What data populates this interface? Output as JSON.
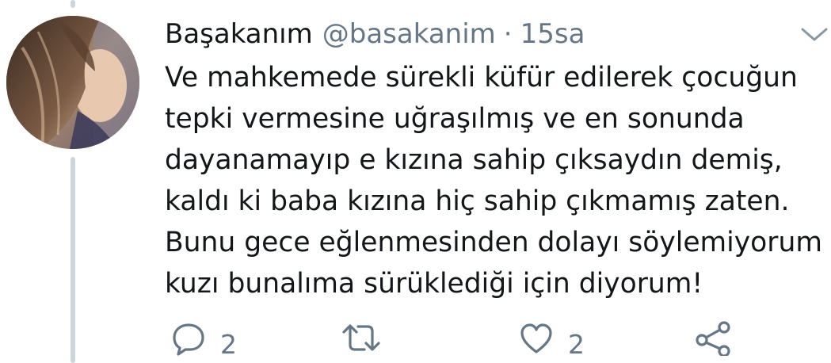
{
  "tweet": {
    "display_name": "Başakanım",
    "handle": "@basakanim",
    "separator": "·",
    "time": "15sa",
    "text_lines": [
      "Ve mahkemede sürekli küfür edilerek çocuğun",
      "tepki vermesine uğraşılmış ve en sonunda",
      "dayanamayıp e kızına sahip çıksaydın demiş,",
      "kaldı ki baba kızına hiç sahip çıkmamış zaten.",
      "Bunu gece eğlenmesinden dolayı söylemiyorum",
      "kuzı bunalıma sürüklediği için diyorum!"
    ]
  },
  "actions": {
    "reply": {
      "icon": "reply-icon",
      "count": "2"
    },
    "retweet": {
      "icon": "retweet-icon"
    },
    "like": {
      "icon": "heart-icon",
      "count": "2"
    },
    "share": {
      "icon": "share-icon"
    }
  },
  "colors": {
    "text": "#14171a",
    "secondary": "#657786",
    "thread_line": "#ccd6dd"
  }
}
